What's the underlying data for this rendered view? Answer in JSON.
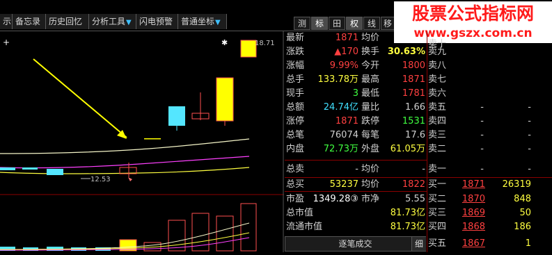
{
  "toolbar": {
    "items": [
      {
        "label": "示",
        "arrow": ""
      },
      {
        "label": "备忘录",
        "arrow": ""
      },
      {
        "label": "历史回忆",
        "arrow": ""
      },
      {
        "label": "分析工具",
        "arrow": "▼"
      },
      {
        "label": "闪电预警",
        "arrow": ""
      },
      {
        "label": "普通坐标",
        "arrow": "▼"
      }
    ],
    "tabs": [
      "测",
      "标",
      "田",
      "权",
      "线",
      "移"
    ],
    "active_tab": "标"
  },
  "watermark": {
    "title": "股票公式指标网",
    "url": "www.gszx.com.cn"
  },
  "chart": {
    "high_label": "18.71",
    "low_label": "12.53",
    "plus_left": "+",
    "star_mark": "✱"
  },
  "quote": {
    "rows": [
      {
        "l1": "最新",
        "v1": "1871",
        "l2": "均价",
        "v2": ""
      },
      {
        "l1": "涨跌",
        "v1": "▲170",
        "l2": "换手",
        "v2": "30.63%"
      },
      {
        "l1": "涨幅",
        "v1": "9.99%",
        "l2": "今开",
        "v2": "1800"
      },
      {
        "l1": "总手",
        "v1": "133.78万",
        "l2": "最高",
        "v2": "1871"
      },
      {
        "l1": "现手",
        "v1": "3",
        "l2": "最低",
        "v2": "1781"
      },
      {
        "l1": "总额",
        "v1": "24.74亿",
        "l2": "量比",
        "v2": "1.66"
      },
      {
        "l1": "涨停",
        "v1": "1871",
        "l2": "跌停",
        "v2": "1531"
      },
      {
        "l1": "总笔",
        "v1": "76074",
        "l2": "每笔",
        "v2": "17.6"
      },
      {
        "l1": "内盘",
        "v1": "72.73万",
        "l2": "外盘",
        "v2": "61.05万"
      },
      {
        "l1": "总卖",
        "v1": "-",
        "l2": "均价",
        "v2": "-"
      },
      {
        "l1": "总买",
        "v1": "53237",
        "l2": "均价",
        "v2": "1822"
      },
      {
        "l1": "市盈",
        "v1": "1349.28③",
        "l2": "市净",
        "v2": "5.55"
      },
      {
        "l1": "总市值",
        "v1": "",
        "l2": "",
        "v2": "81.73亿"
      },
      {
        "l1": "流通市值",
        "v1": "",
        "l2": "",
        "v2": "81.73亿"
      }
    ],
    "sells": [
      {
        "label": "卖十",
        "price": "",
        "vol": ""
      },
      {
        "label": "卖九",
        "price": "",
        "vol": ""
      },
      {
        "label": "卖八",
        "price": "",
        "vol": ""
      },
      {
        "label": "卖七",
        "price": "",
        "vol": ""
      },
      {
        "label": "卖六",
        "price": "",
        "vol": ""
      },
      {
        "label": "卖五",
        "price": "-",
        "vol": "-"
      },
      {
        "label": "卖四",
        "price": "-",
        "vol": "-"
      },
      {
        "label": "卖三",
        "price": "-",
        "vol": "-"
      },
      {
        "label": "卖二",
        "price": "-",
        "vol": "-"
      },
      {
        "label": "卖一",
        "price": "-",
        "vol": "-"
      }
    ],
    "buys": [
      {
        "label": "买一",
        "price": "1871",
        "vol": "26319"
      },
      {
        "label": "买二",
        "price": "1870",
        "vol": "848"
      },
      {
        "label": "买三",
        "price": "1869",
        "vol": "50"
      },
      {
        "label": "买四",
        "price": "1868",
        "vol": "186"
      },
      {
        "label": "买五",
        "price": "1867",
        "vol": "1"
      }
    ]
  },
  "bottom": {
    "ticks_label": "逐笔成交",
    "fine_label": "细"
  }
}
